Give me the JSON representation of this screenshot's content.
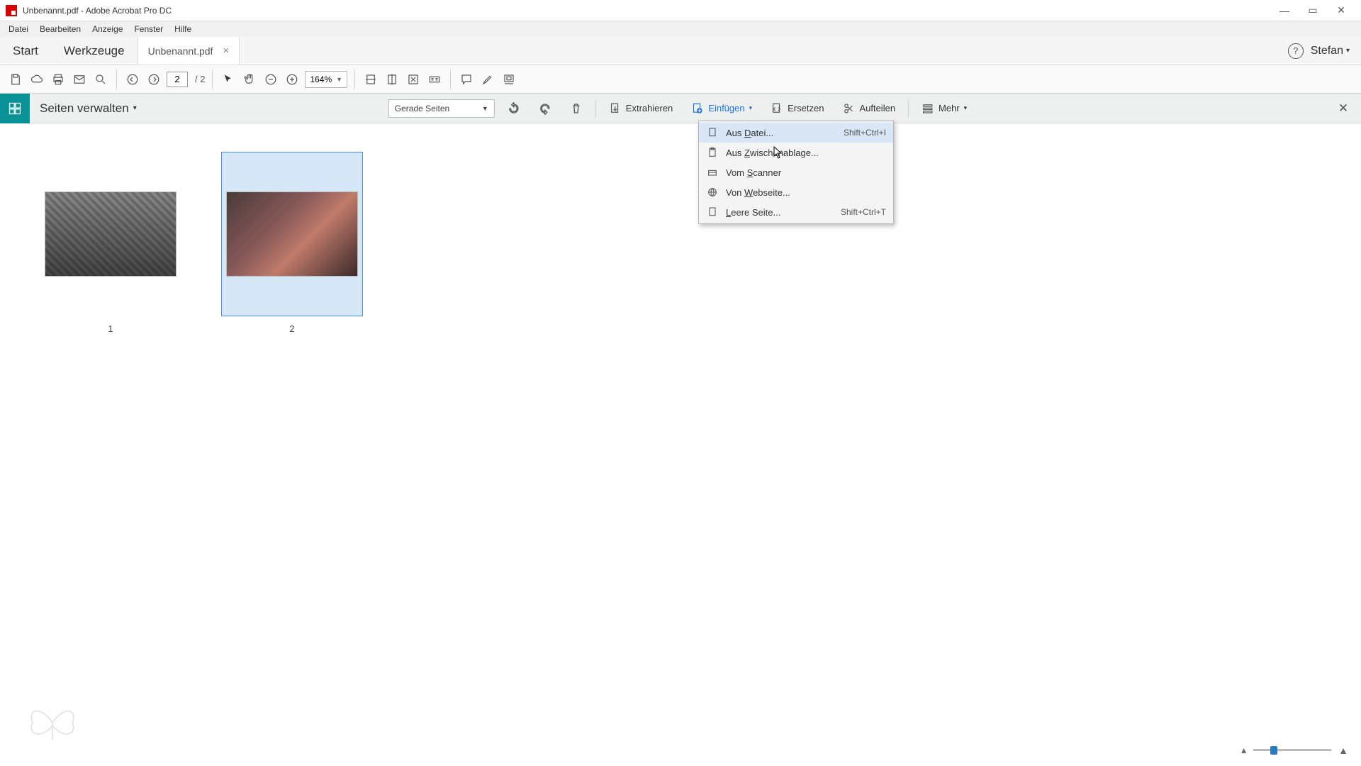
{
  "titlebar": {
    "text": "Unbenannt.pdf - Adobe Acrobat Pro DC"
  },
  "menubar": {
    "items": [
      "Datei",
      "Bearbeiten",
      "Anzeige",
      "Fenster",
      "Hilfe"
    ]
  },
  "tabs": {
    "start": "Start",
    "tools": "Werkzeuge",
    "doc": "Unbenannt.pdf",
    "user": "Stefan"
  },
  "maintoolbar": {
    "page_current": "2",
    "page_total": "/ 2",
    "zoom": "164%"
  },
  "orgbar": {
    "title": "Seiten verwalten",
    "filter": "Gerade Seiten",
    "extract": "Extrahieren",
    "insert": "Einfügen",
    "replace": "Ersetzen",
    "split": "Aufteilen",
    "more": "Mehr"
  },
  "thumbs": {
    "p1": "1",
    "p2": "2"
  },
  "dropdown": {
    "from_file": "Aus Datei...",
    "from_file_sc": "Shift+Ctrl+I",
    "from_clipboard": "Aus Zwischenablage...",
    "from_scanner": "Vom Scanner",
    "from_web": "Von Webseite...",
    "blank_page": "Leere Seite...",
    "blank_page_sc": "Shift+Ctrl+T"
  }
}
